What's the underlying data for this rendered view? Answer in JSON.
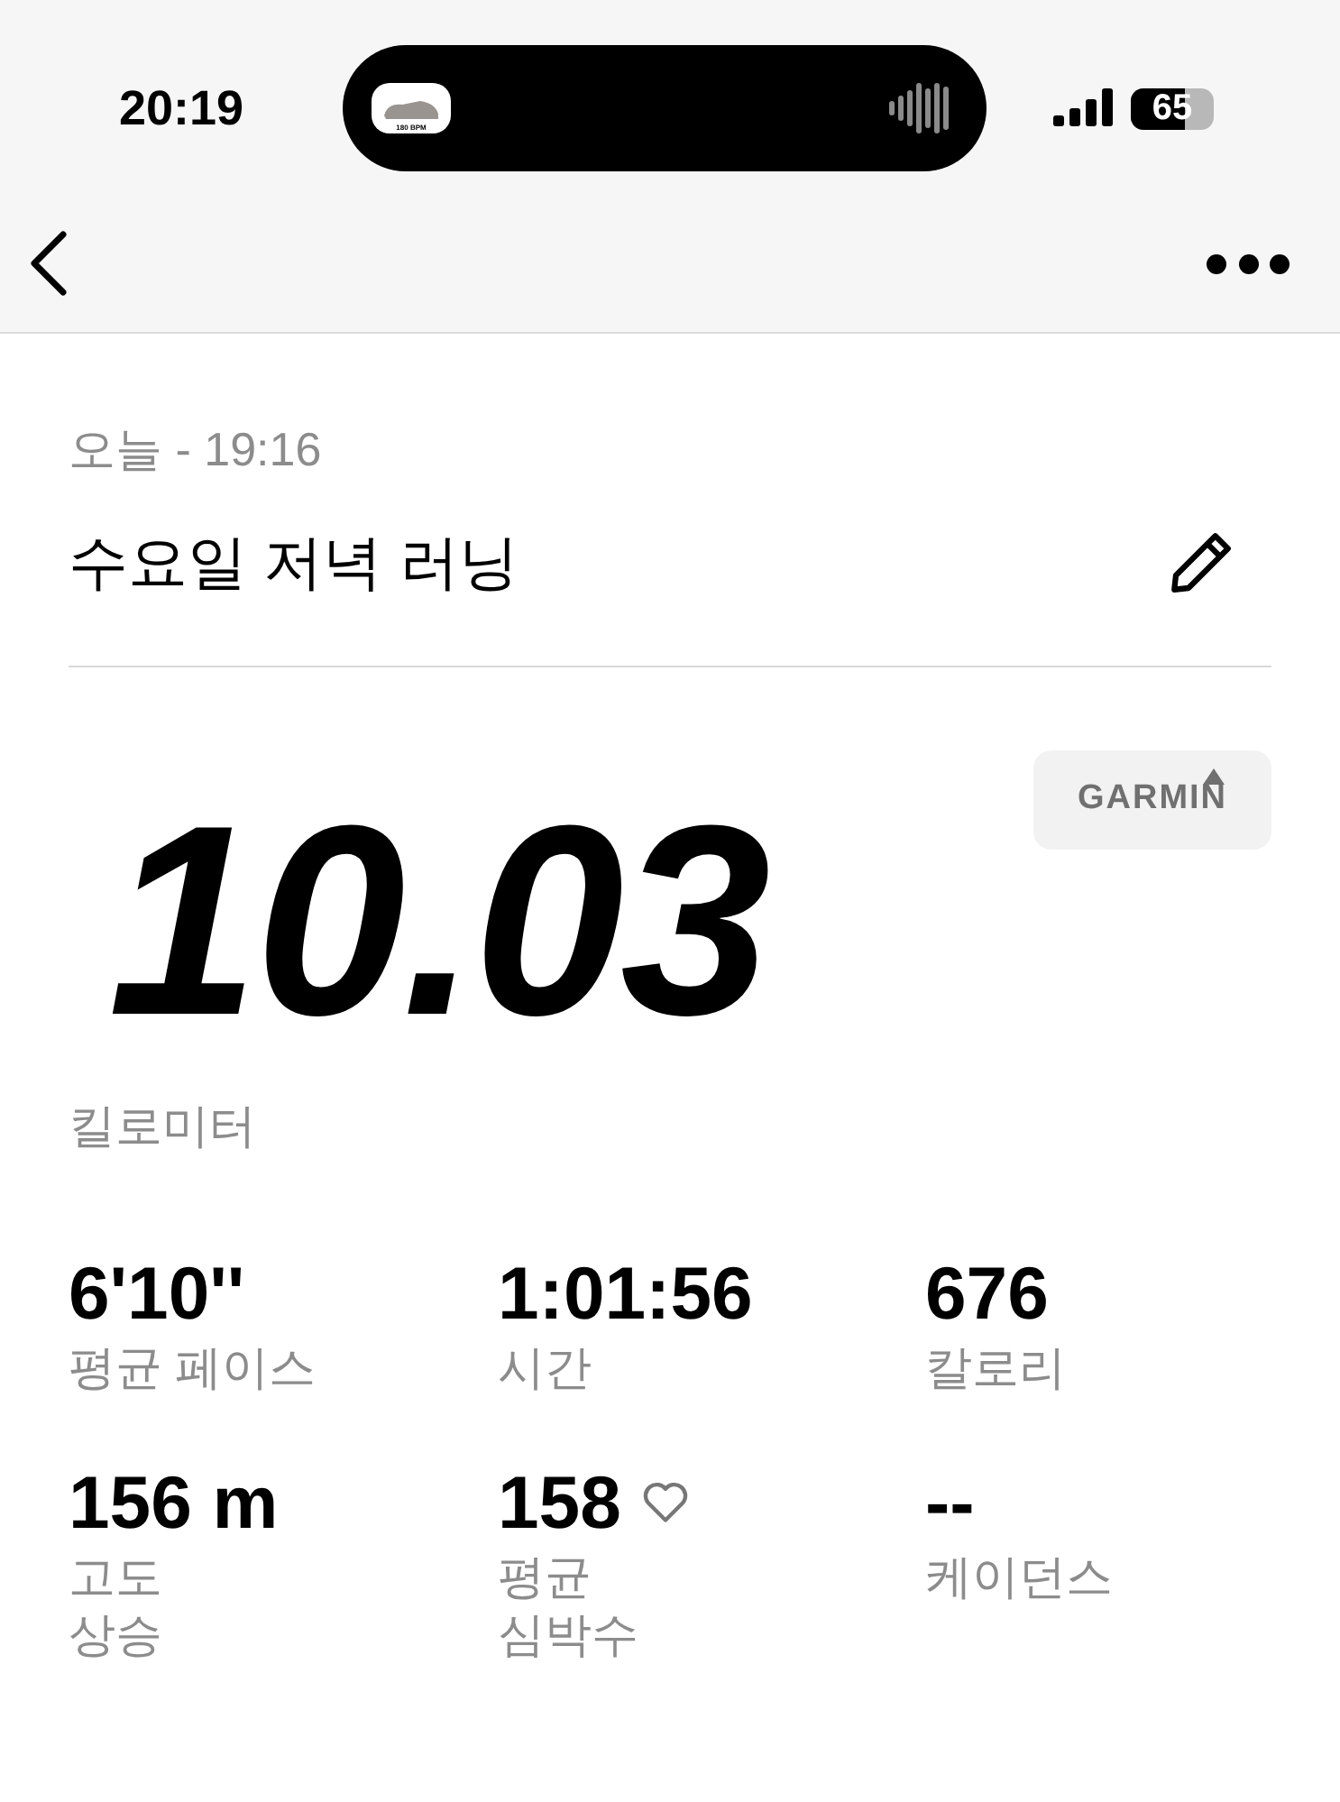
{
  "status_bar": {
    "time": "20:19",
    "island_caption": "180 BPM",
    "battery": "65"
  },
  "activity": {
    "date": "오늘 - 19:16",
    "title": "수요일 저녁 러닝",
    "source": "GARMIN",
    "distance": "10.03",
    "distance_unit": "킬로미터"
  },
  "stats": [
    {
      "value": "6'10''",
      "label": "평균 페이스"
    },
    {
      "value": "1:01:56",
      "label": "시간"
    },
    {
      "value": "676",
      "label": "칼로리"
    },
    {
      "value": "156 m",
      "label": "고도\n상승"
    },
    {
      "value": "158",
      "label": "평균\n심박수",
      "kind": "heart"
    },
    {
      "value": "--",
      "label": "케이던스"
    }
  ]
}
